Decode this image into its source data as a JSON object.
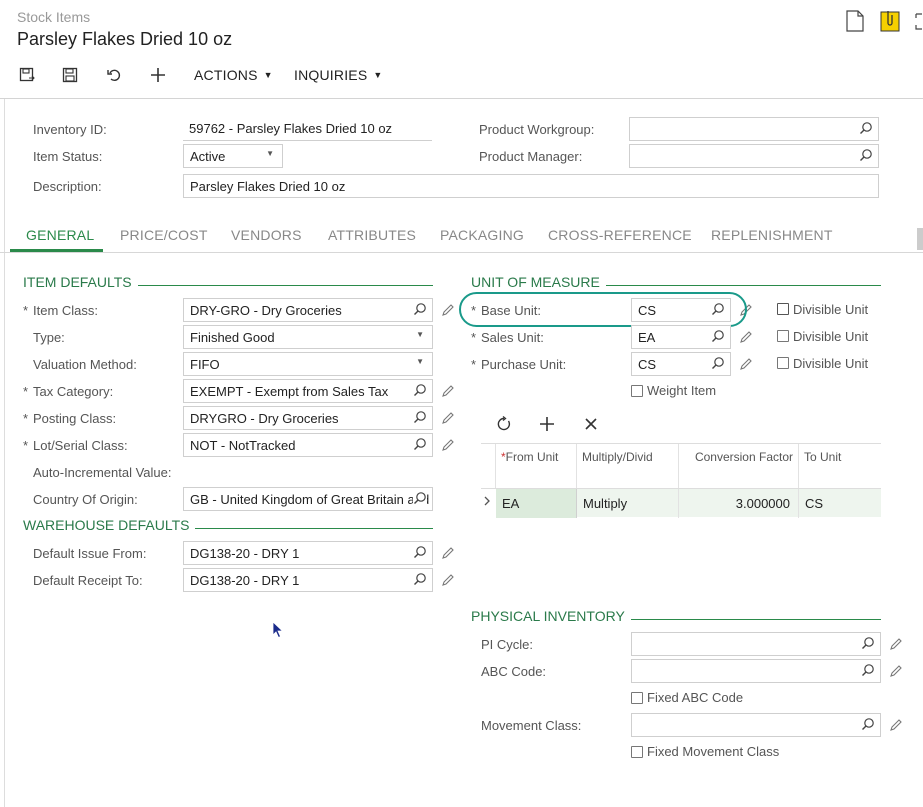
{
  "header": {
    "breadcrumb": "Stock Items",
    "title": "Parsley Flakes Dried 10 oz",
    "toolbar": {
      "actions_label": "ACTIONS",
      "inquiries_label": "INQUIRIES"
    }
  },
  "summary": {
    "inventory_id_label": "Inventory ID:",
    "inventory_id_value": "59762 - Parsley Flakes Dried 10 oz",
    "item_status_label": "Item Status:",
    "item_status_value": "Active",
    "description_label": "Description:",
    "description_value": "Parsley Flakes Dried 10 oz",
    "product_workgroup_label": "Product Workgroup:",
    "product_workgroup_value": "",
    "product_manager_label": "Product Manager:",
    "product_manager_value": ""
  },
  "tabs": [
    "GENERAL",
    "PRICE/COST",
    "VENDORS",
    "ATTRIBUTES",
    "PACKAGING",
    "CROSS-REFERENCE",
    "REPLENISHMENT"
  ],
  "item_defaults": {
    "title": "ITEM DEFAULTS",
    "item_class_label": "Item Class:",
    "item_class_value": "DRY-GRO - Dry Groceries",
    "type_label": "Type:",
    "type_value": "Finished Good",
    "valuation_label": "Valuation Method:",
    "valuation_value": "FIFO",
    "tax_category_label": "Tax Category:",
    "tax_category_value": "EXEMPT - Exempt from Sales Tax",
    "posting_class_label": "Posting Class:",
    "posting_class_value": "DRYGRO - Dry Groceries",
    "lot_serial_label": "Lot/Serial Class:",
    "lot_serial_value": "NOT - NotTracked",
    "auto_incremental_label": "Auto-Incremental Value:",
    "country_label": "Country Of Origin:",
    "country_value": "GB - United Kingdom of Great Britain and"
  },
  "warehouse_defaults": {
    "title": "WAREHOUSE DEFAULTS",
    "issue_from_label": "Default Issue From:",
    "issue_from_value": "DG138-20 - DRY 1",
    "receipt_to_label": "Default Receipt To:",
    "receipt_to_value": "DG138-20 - DRY 1"
  },
  "uom": {
    "title": "UNIT OF MEASURE",
    "base_unit_label": "Base Unit:",
    "base_unit_value": "CS",
    "sales_unit_label": "Sales Unit:",
    "sales_unit_value": "EA",
    "purchase_unit_label": "Purchase Unit:",
    "purchase_unit_value": "CS",
    "divisible_label": "Divisible Unit",
    "weight_item_label": "Weight Item",
    "grid": {
      "headers": [
        "From Unit",
        "Multiply/Divid",
        "Conversion Factor",
        "To Unit"
      ],
      "rows": [
        {
          "from": "EA",
          "op": "Multiply",
          "factor": "3.000000",
          "to": "CS"
        }
      ]
    }
  },
  "physical_inventory": {
    "title": "PHYSICAL INVENTORY",
    "pi_cycle_label": "PI Cycle:",
    "abc_code_label": "ABC Code:",
    "fixed_abc_label": "Fixed ABC Code",
    "movement_class_label": "Movement Class:",
    "fixed_movement_label": "Fixed Movement Class"
  },
  "colors": {
    "accent": "#2a8a4a",
    "highlight_circle": "#1a9a8a",
    "grid_row_bg": "#eef5ee"
  }
}
